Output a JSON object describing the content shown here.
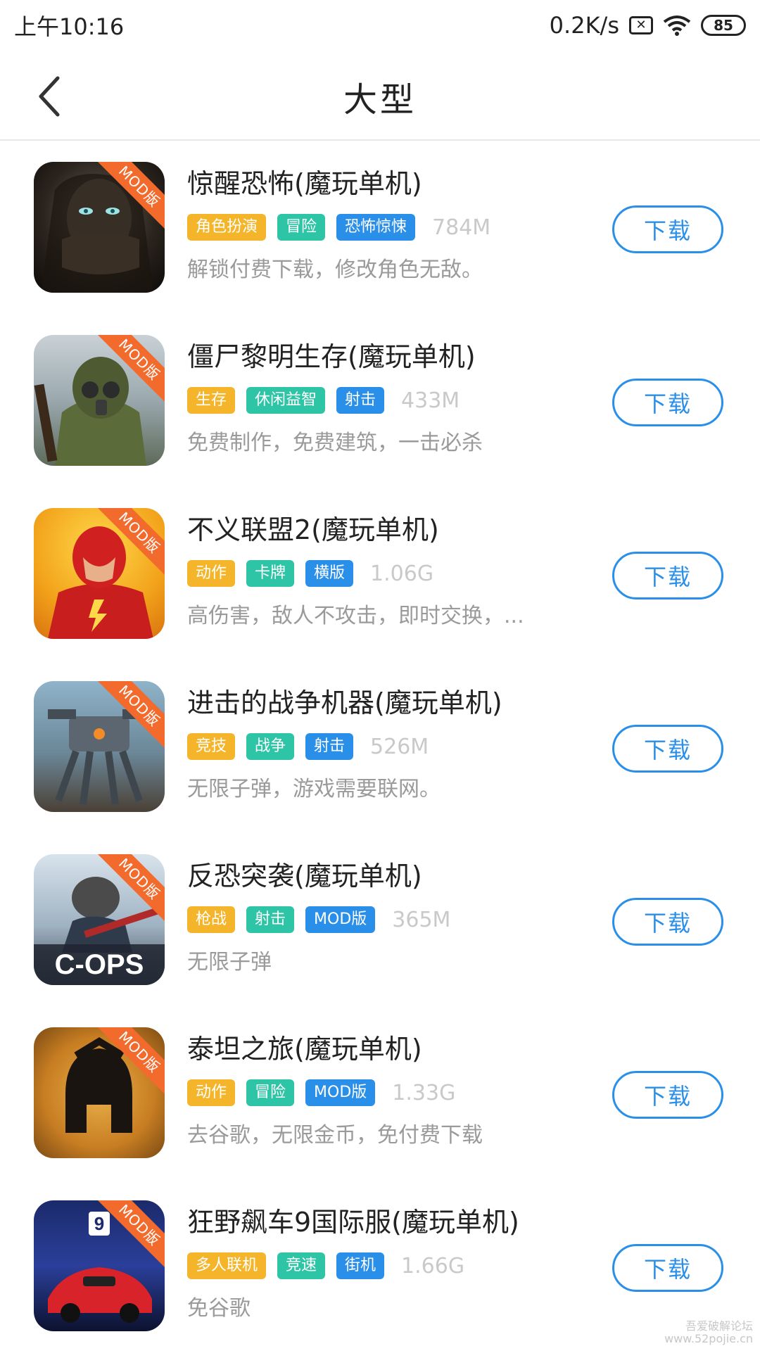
{
  "status": {
    "time": "上午10:16",
    "speed": "0.2K/s",
    "sim_label": "✕",
    "battery": "85"
  },
  "nav": {
    "title": "大型"
  },
  "items": [
    {
      "title": "惊醒恐怖(魔玩单机)",
      "badge": "MOD版",
      "tags": [
        {
          "label": "角色扮演",
          "color": "#f5b52b"
        },
        {
          "label": "冒险",
          "color": "#2ec4a6"
        },
        {
          "label": "恐怖惊悚",
          "color": "#2a8fe8"
        }
      ],
      "size": "784M",
      "desc": "解锁付费下载，修改角色无敌。",
      "icon_name": "horror-app-icon"
    },
    {
      "title": "僵尸黎明生存(魔玩单机)",
      "badge": "MOD版",
      "tags": [
        {
          "label": "生存",
          "color": "#f5b52b"
        },
        {
          "label": "休闲益智",
          "color": "#2ec4a6"
        },
        {
          "label": "射击",
          "color": "#2a8fe8"
        }
      ],
      "size": "433M",
      "desc": "免费制作，免费建筑，一击必杀",
      "icon_name": "zombie-app-icon"
    },
    {
      "title": "不义联盟2(魔玩单机)",
      "badge": "MOD版",
      "tags": [
        {
          "label": "动作",
          "color": "#f5b52b"
        },
        {
          "label": "卡牌",
          "color": "#2ec4a6"
        },
        {
          "label": "横版",
          "color": "#2a8fe8"
        }
      ],
      "size": "1.06G",
      "desc": "高伤害，敌人不攻击，即时交换，...",
      "icon_name": "hero-app-icon"
    },
    {
      "title": "进击的战争机器(魔玩单机)",
      "badge": "MOD版",
      "tags": [
        {
          "label": "竞技",
          "color": "#f5b52b"
        },
        {
          "label": "战争",
          "color": "#2ec4a6"
        },
        {
          "label": "射击",
          "color": "#2a8fe8"
        }
      ],
      "size": "526M",
      "desc": "无限子弹，游戏需要联网。",
      "icon_name": "mech-app-icon"
    },
    {
      "title": "反恐突袭(魔玩单机)",
      "badge": "MOD版",
      "tags": [
        {
          "label": "枪战",
          "color": "#f5b52b"
        },
        {
          "label": "射击",
          "color": "#2ec4a6"
        },
        {
          "label": "MOD版",
          "color": "#2a8fe8"
        }
      ],
      "size": "365M",
      "desc": "无限子弹",
      "icon_name": "cops-app-icon"
    },
    {
      "title": "泰坦之旅(魔玩单机)",
      "badge": "MOD版",
      "tags": [
        {
          "label": "动作",
          "color": "#f5b52b"
        },
        {
          "label": "冒险",
          "color": "#2ec4a6"
        },
        {
          "label": "MOD版",
          "color": "#2a8fe8"
        }
      ],
      "size": "1.33G",
      "desc": "去谷歌，无限金币，免付费下载",
      "icon_name": "titan-app-icon"
    },
    {
      "title": "狂野飙车9国际服(魔玩单机)",
      "badge": "MOD版",
      "tags": [
        {
          "label": "多人联机",
          "color": "#f5b52b"
        },
        {
          "label": "竞速",
          "color": "#2ec4a6"
        },
        {
          "label": "街机",
          "color": "#2a8fe8"
        }
      ],
      "size": "1.66G",
      "desc": "免谷歌",
      "icon_name": "racing-app-icon"
    }
  ],
  "download_label": "下载",
  "watermark": {
    "line1": "吾爱破解论坛",
    "line2": "www.52pojie.cn"
  }
}
